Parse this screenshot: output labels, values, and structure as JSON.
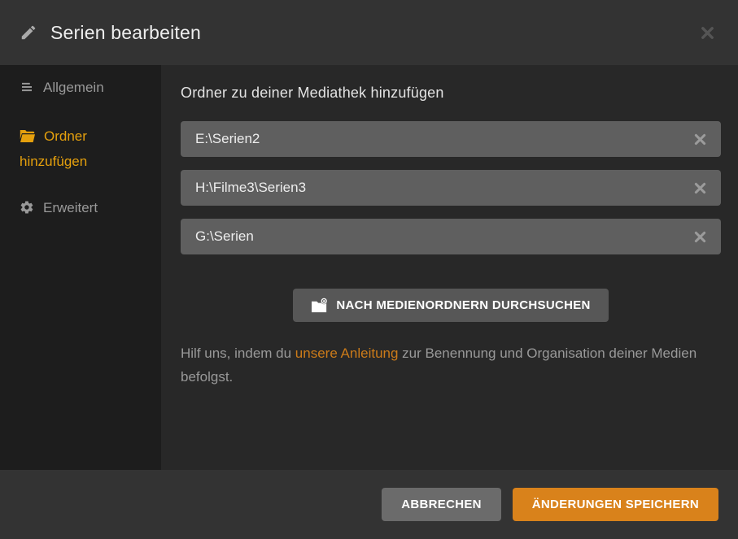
{
  "dialog": {
    "title": "Serien bearbeiten"
  },
  "sidebar": {
    "items": [
      {
        "label": "Allgemein",
        "icon": "list-icon",
        "active": false
      },
      {
        "label": "Ordner hinzufügen",
        "icon": "folder-icon",
        "active": true
      },
      {
        "label": "Erweitert",
        "icon": "gear-icon",
        "active": false
      }
    ]
  },
  "content": {
    "heading": "Ordner zu deiner Mediathek hinzufügen",
    "folders": [
      "E:\\Serien2",
      "H:\\Filme3\\Serien3",
      "G:\\Serien"
    ],
    "browse_button": "NACH MEDIENORDNERN DURCHSUCHEN",
    "help": {
      "before_link": "Hilf uns, indem du ",
      "link": "unsere Anleitung",
      "after_link": " zur Benennung und Organisation deiner Medien befolgst."
    }
  },
  "footer": {
    "cancel_label": "ABBRECHEN",
    "save_label": "ÄNDERUNGEN SPEICHERN"
  },
  "colors": {
    "header-bg": "#333333",
    "sidebar-bg": "#1d1d1d",
    "content-bg": "#282828",
    "field-bg": "#5f5f5f",
    "button-gray": "#575757",
    "cancel-gray": "#6b6b6b",
    "save-orange": "#d9821b",
    "link-orange": "#cc7b19",
    "accent-gold": "#e5a00d",
    "text-muted": "#999999",
    "text-light": "#eeeeee"
  }
}
